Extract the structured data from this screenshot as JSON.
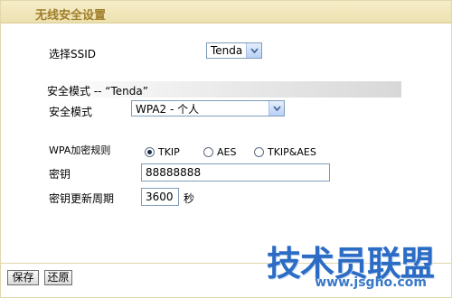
{
  "header": {
    "title": "无线安全设置"
  },
  "ssid": {
    "label": "选择SSID",
    "value": "Tenda"
  },
  "security_section": {
    "title": "安全模式 -- “Tenda”"
  },
  "security_mode": {
    "label": "安全模式",
    "value": "WPA2 - 个人"
  },
  "wpa_rule": {
    "label": "WPA加密规则",
    "options": [
      {
        "label": "TKIP",
        "selected": true
      },
      {
        "label": "AES",
        "selected": false
      },
      {
        "label": "TKIP&AES",
        "selected": false
      }
    ]
  },
  "key": {
    "label": "密钥",
    "value": "88888888"
  },
  "key_renewal": {
    "label": "密钥更新周期",
    "value": "3600",
    "unit": "秒"
  },
  "buttons": {
    "save": "保存",
    "restore": "还原"
  },
  "watermark": {
    "main": "技术员联盟",
    "url": "www.jsgho.com"
  }
}
